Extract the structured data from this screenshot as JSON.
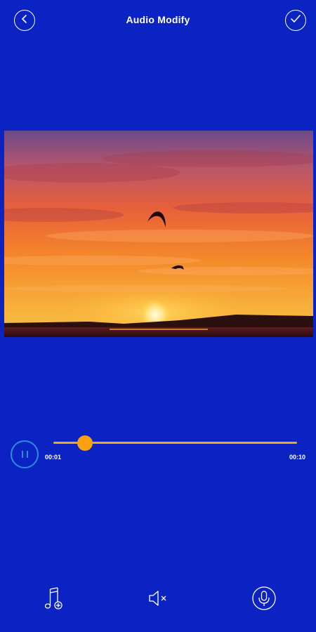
{
  "header": {
    "title": "Audio Modify",
    "back_icon": "chevron-left-icon",
    "done_icon": "check-icon"
  },
  "video": {
    "description_icon": "video-preview"
  },
  "player": {
    "state_icon": "pause-icon",
    "current_time": "00:01",
    "total_time": "00:10",
    "progress": 0.13,
    "accent_color": "#f7a20e",
    "button_color": "#2a8fd6"
  },
  "toolbar": {
    "items": [
      {
        "icon": "add-music-icon"
      },
      {
        "icon": "mute-icon"
      },
      {
        "icon": "microphone-icon"
      }
    ]
  },
  "colors": {
    "background": "#0a23c2"
  }
}
